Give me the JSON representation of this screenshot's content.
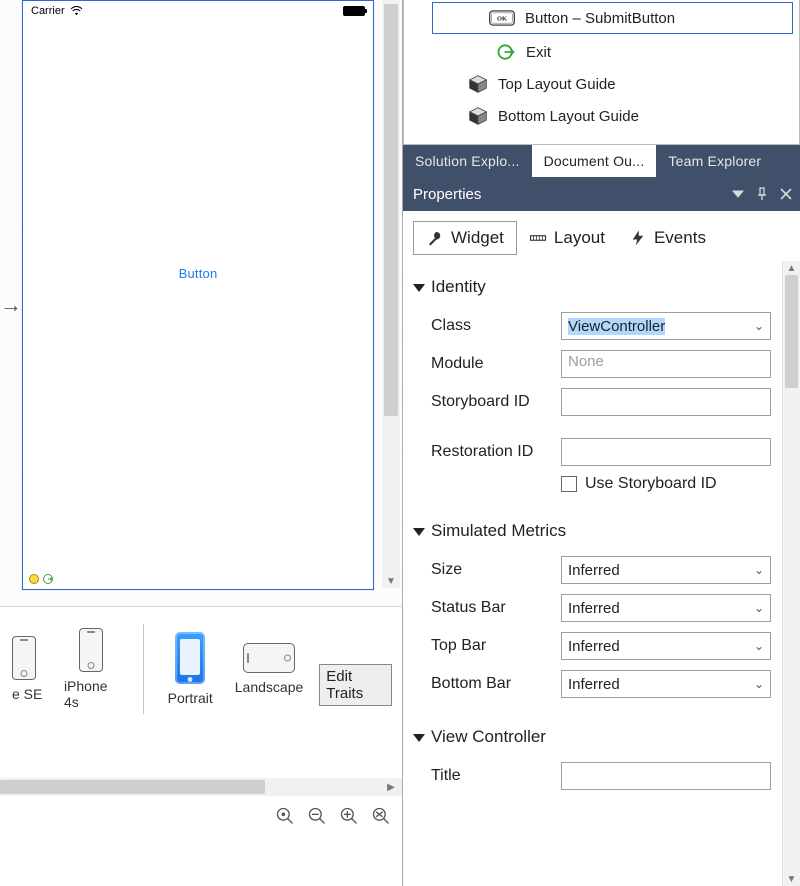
{
  "designer": {
    "statusbar": {
      "carrier": "Carrier"
    },
    "button_label": "Button",
    "devices": {
      "se_label": "e SE",
      "iphone4s_label": "iPhone 4s",
      "portrait_label": "Portrait",
      "landscape_label": "Landscape"
    },
    "edit_traits": "Edit Traits"
  },
  "outline": {
    "button_item": "Button  –  SubmitButton",
    "exit_item": "Exit",
    "top_guide": "Top Layout Guide",
    "bottom_guide": "Bottom Layout Guide"
  },
  "window_tabs": {
    "solution": "Solution Explo...",
    "document": "Document Ou...",
    "team": "Team Explorer"
  },
  "properties": {
    "title": "Properties",
    "tabs": {
      "widget": "Widget",
      "layout": "Layout",
      "events": "Events"
    },
    "groups": {
      "identity": {
        "title": "Identity",
        "class_label": "Class",
        "class_value": "ViewController",
        "module_label": "Module",
        "module_placeholder": "None",
        "storyboard_label": "Storyboard ID",
        "storyboard_value": "",
        "restoration_label": "Restoration ID",
        "restoration_value": "",
        "use_storyboard": "Use Storyboard ID"
      },
      "simmetrics": {
        "title": "Simulated Metrics",
        "size_label": "Size",
        "size_value": "Inferred",
        "status_label": "Status Bar",
        "status_value": "Inferred",
        "topbar_label": "Top Bar",
        "topbar_value": "Inferred",
        "bottombar_label": "Bottom Bar",
        "bottombar_value": "Inferred"
      },
      "viewcontroller": {
        "title": "View Controller",
        "title_label": "Title",
        "title_value": ""
      }
    }
  }
}
